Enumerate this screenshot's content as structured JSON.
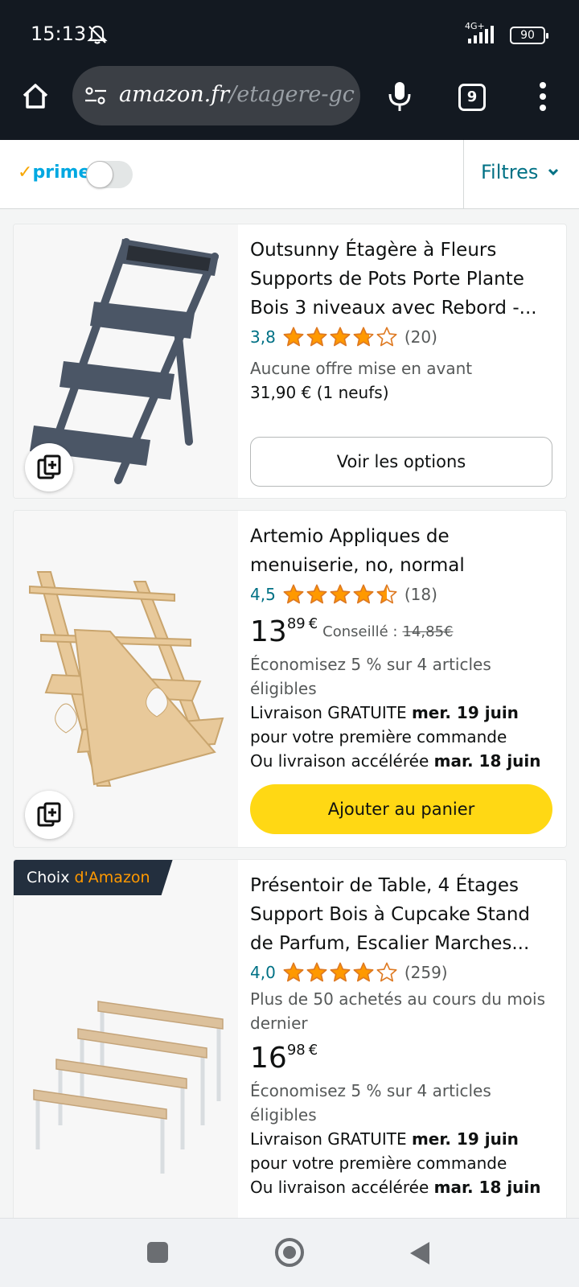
{
  "status": {
    "time": "15:13",
    "network": "4G+",
    "battery": "90"
  },
  "browser": {
    "url_host": "amazon.fr",
    "url_path": "/etagere-gc",
    "tab_count": "9"
  },
  "filter_bar": {
    "prime_label": "prime",
    "prime_enabled": false,
    "filters_label": "Filtres"
  },
  "products": [
    {
      "title": "Outsunny Étagère à Fleurs Supports de Pots Porte Plante Bois 3 niveaux avec Rebord -...",
      "rating": "3,8",
      "stars": 3.8,
      "reviews": "(20)",
      "offer_note": "Aucune offre mise en avant",
      "offer_price": "31,90 € (1 neufs)",
      "button": "Voir les options"
    },
    {
      "title": "Artemio Appliques de menuiserie, no, normal",
      "rating": "4,5",
      "stars": 4.5,
      "reviews": "(18)",
      "price_whole": "13",
      "price_fraction": "89",
      "currency": "€",
      "list_label": "Conseillé :",
      "list_price": "14,85€",
      "savings": "Économisez 5 % sur 4 articles éligibles",
      "delivery_prefix": "Livraison GRATUITE",
      "delivery_date": "mer. 19 juin",
      "delivery_suffix": "pour votre première commande",
      "fast_prefix": "Ou livraison accélérée",
      "fast_date": "mar. 18 juin",
      "button": "Ajouter au panier"
    },
    {
      "badge_prefix": "Choix",
      "badge_accent": "d'Amazon",
      "title": "Présentoir de Table, 4 Étages Support Bois à Cupcake Stand de Parfum, Escalier Marches...",
      "rating": "4,0",
      "stars": 4.0,
      "reviews": "(259)",
      "bought": "Plus de 50 achetés au cours du mois dernier",
      "price_whole": "16",
      "price_fraction": "98",
      "currency": "€",
      "savings": "Économisez 5 % sur 4 articles éligibles",
      "delivery_prefix": "Livraison GRATUITE",
      "delivery_date": "mer. 19 juin",
      "delivery_suffix": "pour votre première commande",
      "fast_prefix": "Ou livraison accélérée",
      "fast_date": "mar. 18 juin"
    }
  ],
  "colors": {
    "header_bg": "#131921",
    "link": "#007185",
    "star": "#ff9900",
    "add_to_cart": "#ffd814",
    "badge_bg": "#232f3e"
  }
}
